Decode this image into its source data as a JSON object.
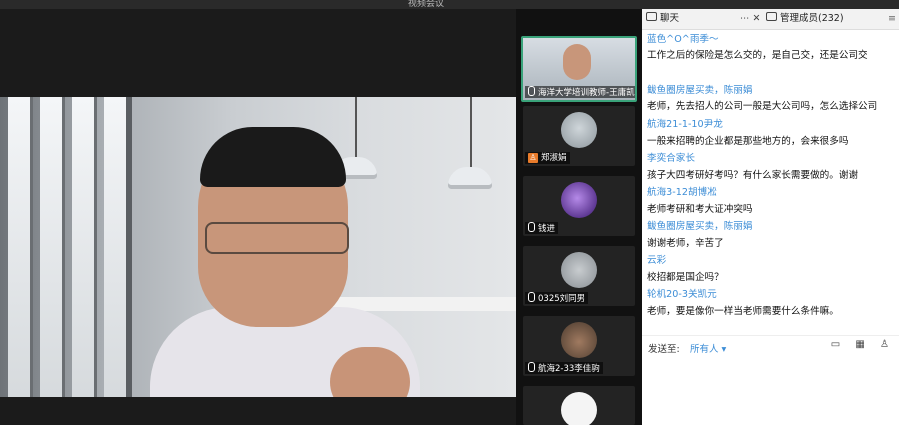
{
  "window": {
    "title": "视频会议"
  },
  "tiles": [
    {
      "name": "海洋大学培训教师-王庸凯",
      "active": true
    },
    {
      "name": "郑淑娟"
    },
    {
      "name": "钱进"
    },
    {
      "name": "0325刘同男"
    },
    {
      "name": "航海2-33李佳驹"
    }
  ],
  "chat": {
    "tab_chat": "聊天",
    "tab_more": "⋯ ✕",
    "tab_members": "管理成员(232)",
    "tab_menu": "≡",
    "messages": [
      {
        "name": "蓝色^O^雨季～",
        "text": "工作之后的保险是怎么交的，是自己交，还是公司交"
      },
      {
        "name": "鲅鱼圈房屋买卖，陈丽娟",
        "text": "老师，先去招人的公司一般是大公司吗，怎么选择公司"
      },
      {
        "name": "航海21-1-10尹龙",
        "text": "一般来招聘的企业都是那些地方的，会来很多吗"
      },
      {
        "name": "李奕合家长",
        "text": "孩子大四考研好考吗？有什么家长需要做的。谢谢"
      },
      {
        "name": "航海3-12胡博凇",
        "text": "老师考研和考大证冲突吗"
      },
      {
        "name": "鲅鱼圈房屋买卖，陈丽娟",
        "text": "谢谢老师，辛苦了"
      },
      {
        "name": "云彩",
        "text": "校招都是国企吗？"
      },
      {
        "name": "轮机20-3关凯元",
        "text": "老师，要是像你一样当老师需要什么条件嘛。"
      }
    ],
    "send_label": "发送至:",
    "send_target": "所有人 ▾",
    "send_icons": "▭ ▦ ♙"
  },
  "colors": {
    "accent_name": "#3c8dd6",
    "active_border": "#3aa37a"
  }
}
